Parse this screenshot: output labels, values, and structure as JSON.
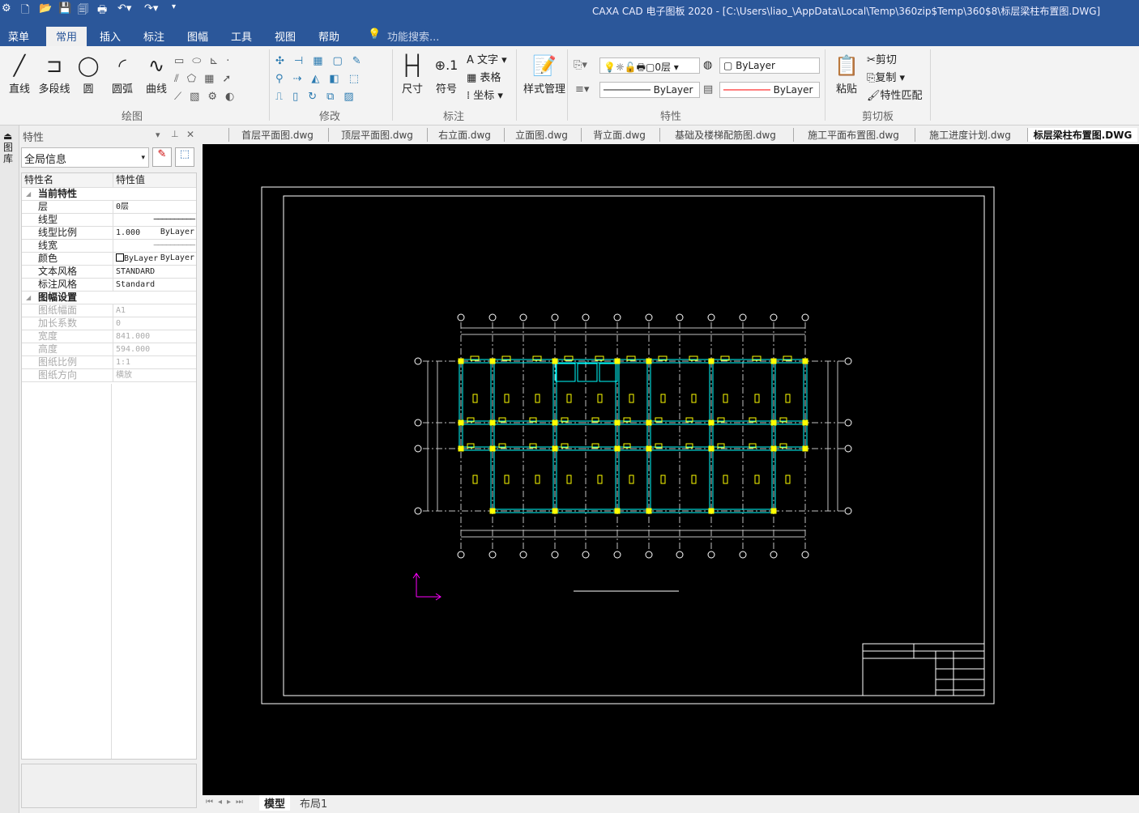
{
  "app": {
    "title": "CAXA CAD 电子图板 2020 - [C:\\Users\\liao_\\AppData\\Local\\Temp\\360zip$Temp\\360$8\\标层梁柱布置图.DWG]"
  },
  "quick_access": [
    "new-icon",
    "open-icon",
    "save-icon",
    "save-as-icon",
    "print-icon",
    "undo-icon",
    "redo-icon",
    "customize-icon"
  ],
  "menu_tabs": [
    "菜单",
    "常用",
    "插入",
    "标注",
    "图幅",
    "工具",
    "视图",
    "帮助"
  ],
  "active_menu_tab": "常用",
  "search": {
    "placeholder": "功能搜索..."
  },
  "ribbon": {
    "draw": {
      "label": "绘图",
      "buttons": [
        "直线",
        "多段线",
        "圆",
        "圆弧",
        "曲线"
      ]
    },
    "modify": {
      "label": "修改"
    },
    "annotate": {
      "label": "标注",
      "buttons": [
        "尺寸",
        "符号"
      ],
      "small": [
        "文字",
        "表格",
        "坐标"
      ]
    },
    "style": {
      "button": "样式管理"
    },
    "properties": {
      "label": "特性",
      "layer": "0层",
      "color": "ByLayer",
      "linetype": "ByLayer",
      "lineweight": "ByLayer"
    },
    "clipboard": {
      "label": "剪切板",
      "paste": "粘贴",
      "cut": "剪切",
      "copy": "复制",
      "match": "特性匹配"
    }
  },
  "side_strip": {
    "label": "图库"
  },
  "properties_panel": {
    "title": "特性",
    "selector": "全局信息",
    "col_name": "特性名",
    "col_value": "特性值",
    "sections": [
      {
        "title": "当前特性",
        "rows": [
          {
            "name": "层",
            "value": "0层"
          },
          {
            "name": "线型",
            "value": "ByLayer"
          },
          {
            "name": "线型比例",
            "value": "1.000"
          },
          {
            "name": "线宽",
            "value": "ByLayer"
          },
          {
            "name": "颜色",
            "value": "ByLayer"
          },
          {
            "name": "文本风格",
            "value": "STANDARD"
          },
          {
            "name": "标注风格",
            "value": "Standard"
          }
        ]
      },
      {
        "title": "图幅设置",
        "rows": [
          {
            "name": "图纸幅面",
            "value": "A1"
          },
          {
            "name": "加长系数",
            "value": "0"
          },
          {
            "name": "宽度",
            "value": "841.000"
          },
          {
            "name": "高度",
            "value": "594.000"
          },
          {
            "name": "图纸比例",
            "value": "1:1"
          },
          {
            "name": "图纸方向",
            "value": "横放"
          }
        ]
      }
    ]
  },
  "doc_tabs": [
    "首层平面图.dwg",
    "顶层平面图.dwg",
    "右立面.dwg",
    "立面图.dwg",
    "背立面.dwg",
    "基础及楼梯配筋图.dwg",
    "施工平面布置图.dwg",
    "施工进度计划.dwg",
    "标层梁柱布置图.DWG"
  ],
  "active_doc_tab": "标层梁柱布置图.DWG",
  "layout_tabs": [
    "模型",
    "布局1"
  ],
  "colors": {
    "title_bar": "#2b579a",
    "canvas": "#000000",
    "beam": "#00ffff",
    "column": "#ffff00",
    "axis": "#c0c0c0",
    "ucs": "#ff00ff"
  }
}
